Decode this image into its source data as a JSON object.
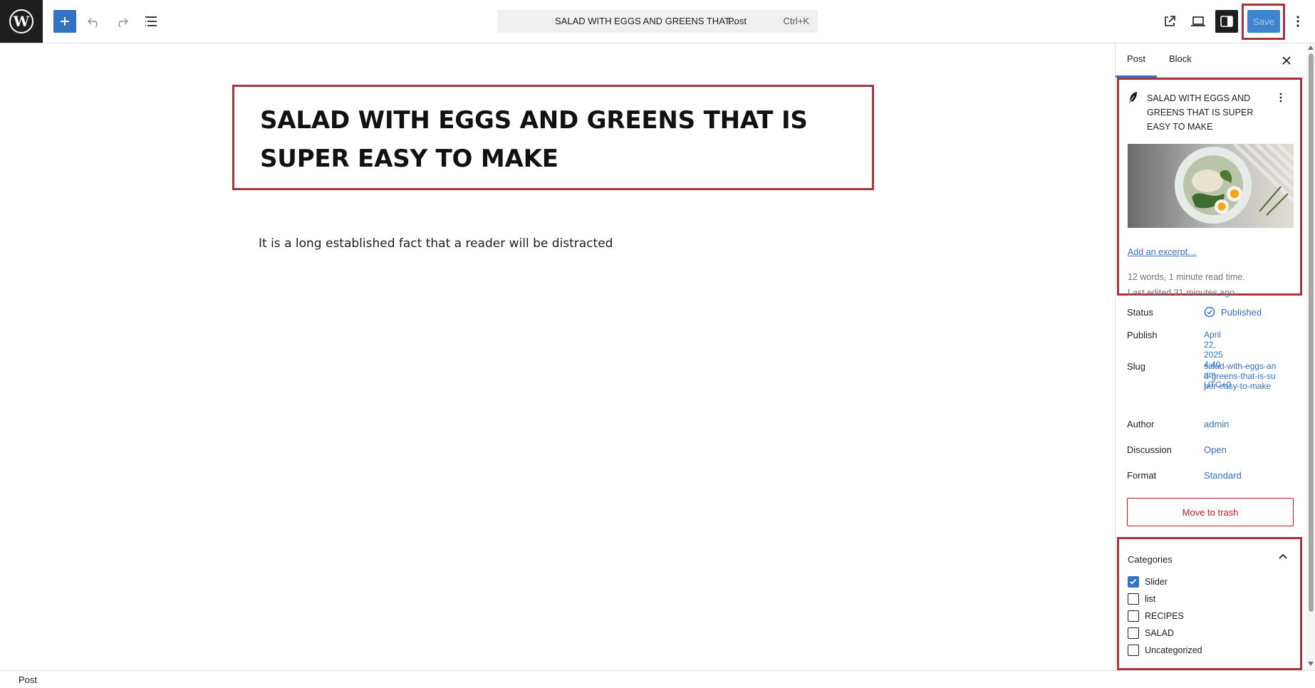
{
  "toolbar": {
    "command_title": "SALAD WITH EGGS AND GREENS THAT...",
    "command_type": "· Post",
    "command_shortcut": "Ctrl+K",
    "save_label": "Save"
  },
  "editor": {
    "title": "SALAD WITH EGGS AND GREENS THAT IS SUPER EASY TO MAKE",
    "paragraph": "It is a long established fact that a reader will be distracted"
  },
  "sidebar": {
    "tabs": [
      {
        "label": "Post"
      },
      {
        "label": "Block"
      }
    ],
    "summary": {
      "title": "SALAD WITH EGGS AND GREENS THAT IS SUPER EASY TO MAKE",
      "excerpt_link": "Add an excerpt…",
      "word_count": "12 words, 1 minute read time.",
      "last_edited": "Last edited 31 minutes ago."
    },
    "meta": {
      "status_label": "Status",
      "status_value": "Published",
      "publish_label": "Publish",
      "publish_date": "April 22, 2025",
      "publish_time": "4:40 am UTC+0",
      "slug_label": "Slug",
      "slug_value": "salad-with-eggs-and-greens-that-is-super-easy-to-make",
      "author_label": "Author",
      "author_value": "admin",
      "discussion_label": "Discussion",
      "discussion_value": "Open",
      "format_label": "Format",
      "format_value": "Standard"
    },
    "trash_label": "Move to trash",
    "categories": {
      "heading": "Categories",
      "items": [
        {
          "label": "Slider",
          "checked": true
        },
        {
          "label": "list",
          "checked": false
        },
        {
          "label": "RECIPES",
          "checked": false
        },
        {
          "label": "SALAD",
          "checked": false
        },
        {
          "label": "Uncategorized",
          "checked": false
        }
      ]
    }
  },
  "footer": {
    "breadcrumb": "Post"
  },
  "colors": {
    "accent": "#3172c5",
    "highlight": "#a8343f",
    "danger": "#cc1818"
  }
}
